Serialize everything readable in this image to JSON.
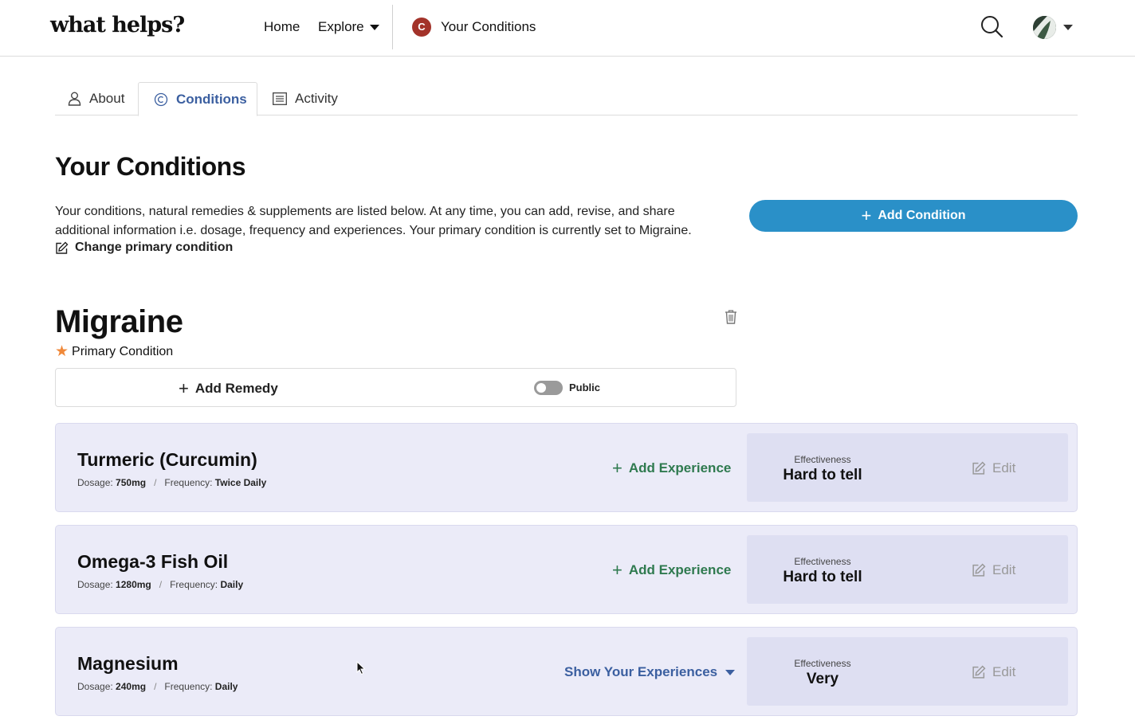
{
  "nav": {
    "logo": "what helps?",
    "home": "Home",
    "explore": "Explore",
    "condition_badge": "C",
    "your_conditions": "Your Conditions"
  },
  "tabs": [
    {
      "label": "About",
      "icon": "user-icon"
    },
    {
      "label": "Conditions",
      "icon": "copyright-icon",
      "active": true
    },
    {
      "label": "Activity",
      "icon": "list-icon"
    }
  ],
  "page": {
    "title": "Your Conditions",
    "intro": "Your conditions, natural remedies & supplements are listed below. At any time, you can add, revise, and share additional information i.e. dosage, frequency and experiences. Your primary condition is currently set to Migraine.",
    "change_primary": "Change primary condition",
    "add_condition": "Add Condition"
  },
  "condition": {
    "name": "Migraine",
    "primary_label": "Primary Condition",
    "add_remedy": "Add Remedy",
    "public_label": "Public",
    "public_on": false
  },
  "remedies": [
    {
      "name": "Turmeric (Curcumin)",
      "dosage_label": "Dosage:",
      "dosage": "750mg",
      "frequency_label": "Frequency:",
      "frequency": "Twice Daily",
      "action": "Add Experience",
      "effectiveness_label": "Effectiveness",
      "effectiveness": "Hard to tell",
      "edit": "Edit"
    },
    {
      "name": "Omega-3 Fish Oil",
      "dosage_label": "Dosage:",
      "dosage": "1280mg",
      "frequency_label": "Frequency:",
      "frequency": "Daily",
      "action": "Add Experience",
      "effectiveness_label": "Effectiveness",
      "effectiveness": "Hard to tell",
      "edit": "Edit"
    },
    {
      "name": "Magnesium",
      "dosage_label": "Dosage:",
      "dosage": "240mg",
      "frequency_label": "Frequency:",
      "frequency": "Daily",
      "action": "Show Your Experiences",
      "effectiveness_label": "Effectiveness",
      "effectiveness": "Very",
      "edit": "Edit"
    }
  ],
  "colors": {
    "primary_button": "#2a90c8",
    "active_tab": "#3b5fa0",
    "add_experience": "#2f7a4f",
    "card_bg": "#ebebf8",
    "badge": "#a3332a",
    "star": "#f0893a"
  }
}
